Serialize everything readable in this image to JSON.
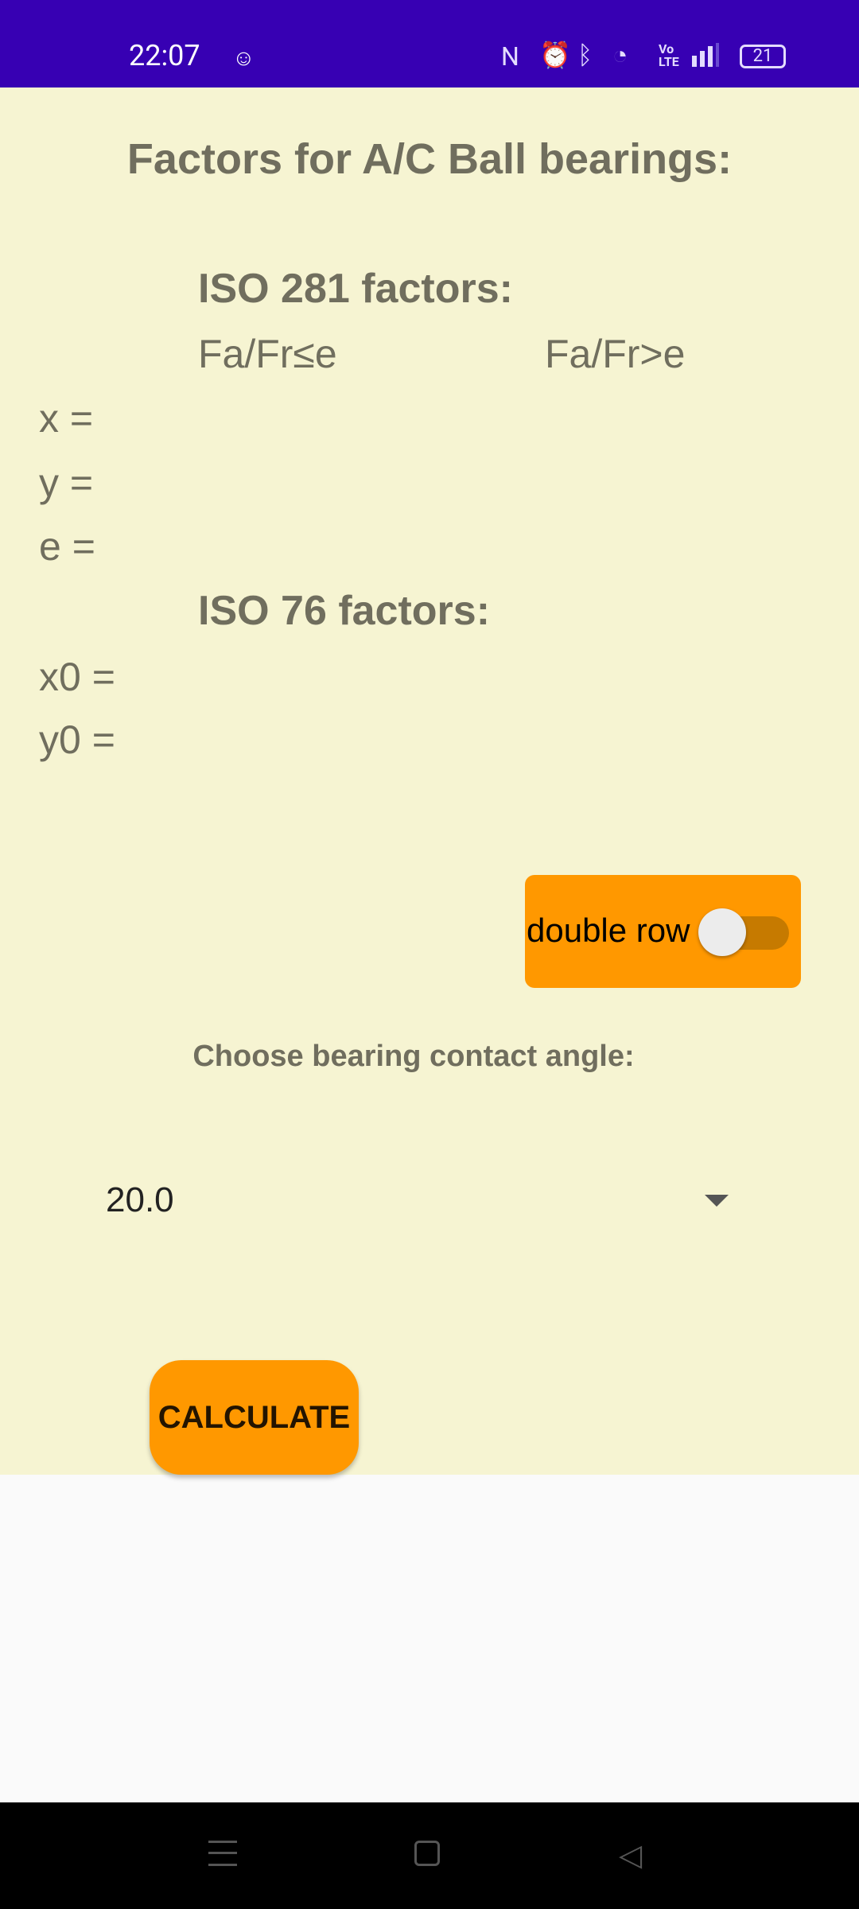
{
  "status_bar": {
    "time": "22:07",
    "battery": "21",
    "icons": [
      "nfc-icon",
      "alarm-icon",
      "bluetooth-icon",
      "wifi-icon",
      "volte-icon",
      "signal-icon",
      "battery-icon"
    ]
  },
  "title": "Factors for A/C Ball bearings:",
  "iso281": {
    "heading": "ISO 281 factors:",
    "col1": "Fa/Fr≤e",
    "col2": "Fa/Fr>e",
    "x": "x =",
    "y": "y =",
    "e": "e ="
  },
  "iso76": {
    "heading": "ISO 76 factors:",
    "x0": "x0 =",
    "y0": "y0 ="
  },
  "double_row": {
    "label": "double row",
    "checked": false
  },
  "contact_angle": {
    "label": "Choose bearing contact angle:",
    "selected": "20.0"
  },
  "calculate": "CALCULATE",
  "colors": {
    "status_bar": "#3700b3",
    "background": "#f6f4d2",
    "accent": "#ff9800",
    "text": "#706e5e"
  }
}
